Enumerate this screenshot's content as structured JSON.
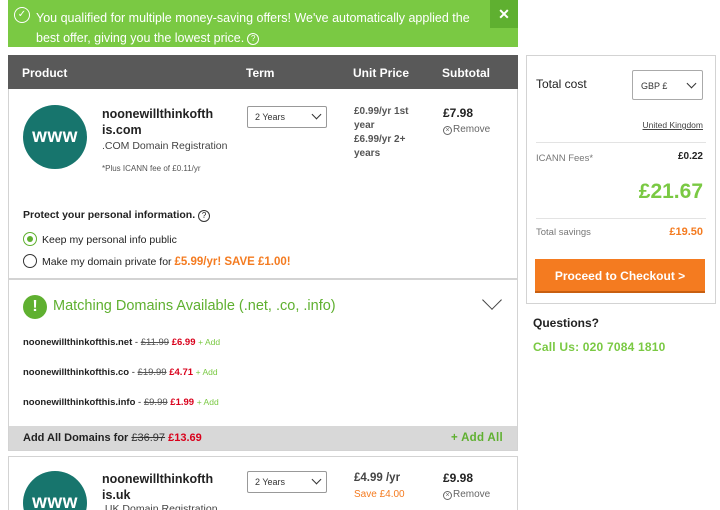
{
  "banner": {
    "message": "You qualified for multiple money-saving offers! We've automatically applied the best offer, giving you the lowest price.",
    "help_icon": "?",
    "close": "✕"
  },
  "cart": {
    "headers": {
      "product": "Product",
      "term": "Term",
      "unit_price": "Unit Price",
      "subtotal": "Subtotal"
    },
    "items": [
      {
        "logo": "www",
        "domain_line1": "noonewillthinkofth",
        "domain_line2": "is.com",
        "type": ".COM Domain Registration",
        "note": "*Plus ICANN fee of £0.11/yr",
        "term": "2 Years",
        "price_line1": "£0.99/yr 1st",
        "price_line2": "year",
        "price_line3": "£6.99/yr 2+",
        "price_line4": "years",
        "subtotal": "£7.98",
        "remove": "Remove"
      },
      {
        "logo": "www",
        "domain_line1": "noonewillthinkofth",
        "domain_line2": "is.uk",
        "type": ".UK Domain Registration",
        "term": "2 Years",
        "price": "£4.99 /yr",
        "save": "Save £4.00",
        "subtotal": "£9.98",
        "remove": "Remove"
      }
    ],
    "privacy": {
      "title": "Protect your personal information.",
      "opt_public": "Keep my personal info public",
      "opt_private_prefix": "Make my domain private for ",
      "opt_private_offer": "£5.99/yr! SAVE £1.00!"
    },
    "matching": {
      "title": "Matching Domains Available (.net, .co, .info)",
      "domains": [
        {
          "name": "noonewillthinkofthis.net",
          "old": "£11.99",
          "new": "£6.99",
          "add": "+ Add"
        },
        {
          "name": "noonewillthinkofthis.co",
          "old": "£19.99",
          "new": "£4.71",
          "add": "+ Add"
        },
        {
          "name": "noonewillthinkofthis.info",
          "old": "£9.99",
          "new": "£1.99",
          "add": "+ Add"
        }
      ],
      "add_all_label": "Add All Domains for",
      "add_all_old": "£36.97",
      "add_all_new": "£13.69",
      "add_all_button": "+ Add All"
    }
  },
  "summary": {
    "total_cost_label": "Total cost",
    "currency": "GBP £",
    "country": "United Kingdom",
    "icann_label": "ICANN Fees",
    "icann_value": "£0.22",
    "total": "£21.67",
    "savings_label": "Total savings",
    "savings_value": "£19.50",
    "checkout": "Proceed to Checkout >"
  },
  "contact": {
    "questions": "Questions?",
    "call": "Call Us: 020 7084 1810"
  },
  "colors": {
    "green": "#7ac943",
    "orange": "#f47b20",
    "teal": "#17756d",
    "red": "#d9001b"
  }
}
